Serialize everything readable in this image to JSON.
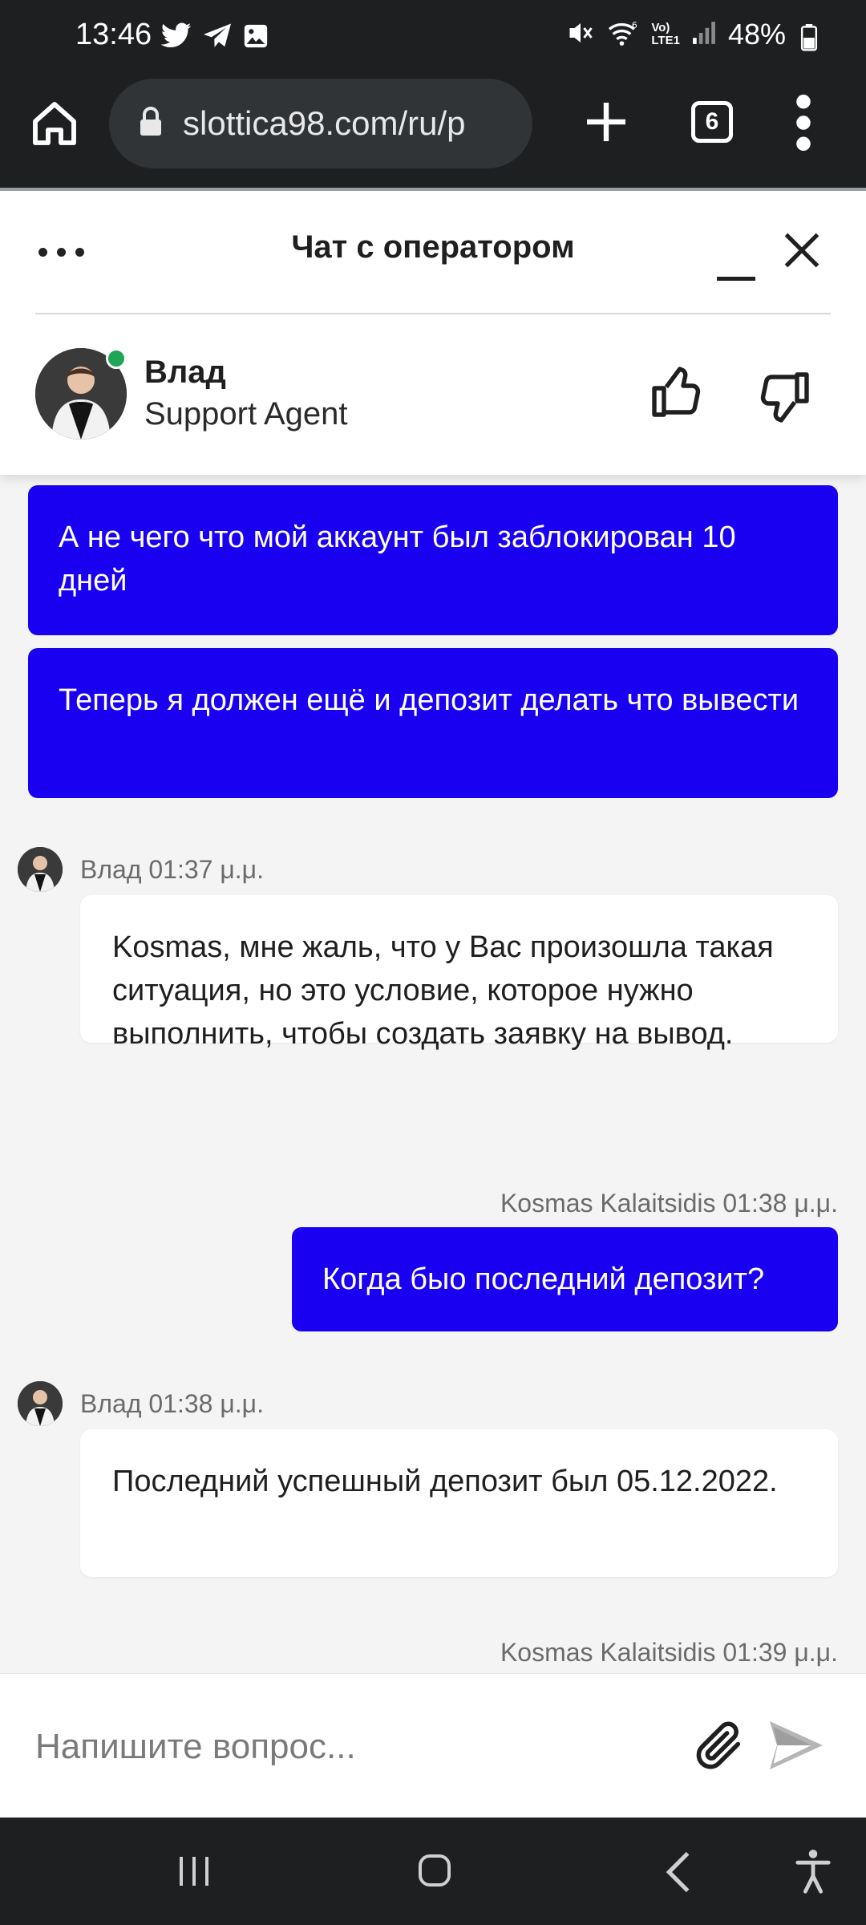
{
  "status_bar": {
    "time": "13:46",
    "battery": "48%",
    "icons_left": [
      "twitter-icon",
      "telegram-icon",
      "gallery-icon"
    ],
    "icons_right": [
      "mute-icon",
      "wifi-6-icon",
      "volte-icon",
      "signal-icon",
      "battery-icon"
    ],
    "network_label_top": "Vo)",
    "network_label_bottom": "LTE1"
  },
  "browser": {
    "url": "slottica98.com/ru/p",
    "tab_count": "6"
  },
  "chat": {
    "title": "Чат с оператором",
    "agent": {
      "name": "Влад",
      "role": "Support Agent",
      "status": "online",
      "status_color": "#1fa555"
    },
    "accent_color": "#1a00f0",
    "messages": [
      {
        "from": "user",
        "text": "А не чего что мой аккаунт был заблокирован 10 дней"
      },
      {
        "from": "user",
        "text": "Теперь я должен ещё и депозит делать что вывести"
      },
      {
        "from": "agent",
        "meta": "Влад 01:37 μ.μ.",
        "text": "Kosmas, мне жаль, что у Вас произошла такая ситуация, но это условие, которое нужно выполнить, чтобы создать заявку на вывод."
      },
      {
        "from": "user",
        "meta": "Kosmas Kalaitsidis 01:38 μ.μ.",
        "text": "Когда быо последний депозит?"
      },
      {
        "from": "agent",
        "meta": "Влад 01:38 μ.μ.",
        "text": "Последний успешный депозит был 05.12.2022."
      },
      {
        "from": "user",
        "meta": "Kosmas Kalaitsidis 01:39 μ.μ.",
        "text": ""
      }
    ],
    "composer": {
      "placeholder": "Напишите вопрос..."
    }
  }
}
